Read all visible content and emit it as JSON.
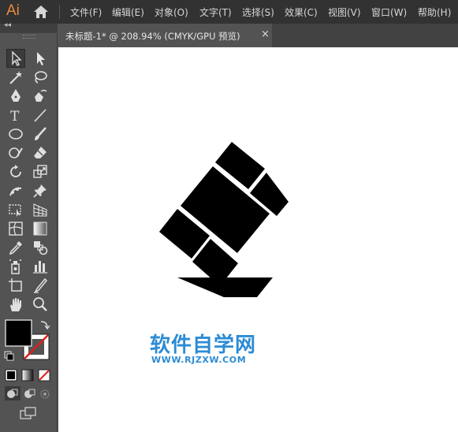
{
  "app": {
    "logo_text": "Ai",
    "accent_color": "#e8893b"
  },
  "menu": {
    "items": [
      "文件(F)",
      "编辑(E)",
      "对象(O)",
      "文字(T)",
      "选择(S)",
      "效果(C)",
      "视图(V)",
      "窗口(W)",
      "帮助(H)"
    ]
  },
  "toolbar": {
    "collapse_label": "◂◂",
    "fill_color": "#000000",
    "stroke_color": "none",
    "tools": [
      "selection-tool",
      "direct-selection-tool",
      "magic-wand-tool",
      "lasso-tool",
      "pen-tool",
      "curvature-tool",
      "type-tool",
      "line-segment-tool",
      "ellipse-tool",
      "paintbrush-tool",
      "shaper-tool",
      "eraser-tool",
      "rotate-tool",
      "scale-tool",
      "puppet-warp-tool",
      "pin-tool",
      "free-transform-tool",
      "perspective-grid-tool",
      "mesh-tool",
      "gradient-tool",
      "eyedropper-tool",
      "blend-tool",
      "symbol-sprayer-tool",
      "column-graph-tool",
      "artboard-tool",
      "slice-tool",
      "hand-tool",
      "zoom-tool"
    ]
  },
  "document": {
    "tab_title": "未标题-1* @ 208.94% (CMYK/GPU 预览)",
    "close_glyph": "×"
  },
  "watermark": {
    "text": "软件自学网",
    "url": "WWW.RJZXW.COM",
    "color": "#2d8bd3"
  }
}
